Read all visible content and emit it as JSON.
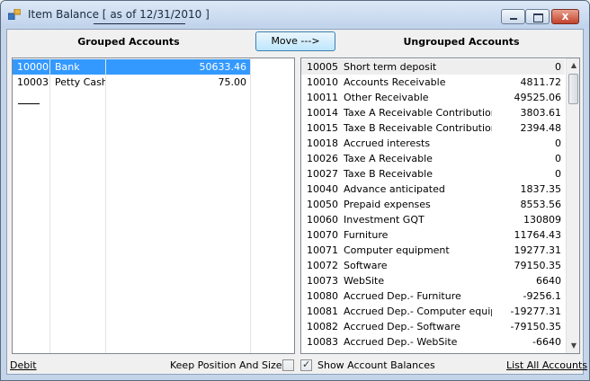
{
  "window": {
    "title_prefix": "Item Balance [",
    "title_date": "as of 12/31/2010",
    "title_suffix": "]",
    "minimize_icon": "minimize-icon",
    "maximize_icon": "maximize-icon",
    "close_glyph": "x"
  },
  "headings": {
    "grouped": "Grouped Accounts",
    "ungrouped": "Ungrouped Accounts"
  },
  "move_button": "Move --->",
  "grouped_accounts": [
    {
      "code": "10000",
      "name": "Bank",
      "value": "50633.46",
      "selected": true
    },
    {
      "code": "10003",
      "name": "Petty Cash",
      "value": "75.00",
      "selected": false
    }
  ],
  "ungrouped_accounts": [
    {
      "code": "10005",
      "name": "Short term deposit",
      "value": "0"
    },
    {
      "code": "10010",
      "name": "Accounts Receivable",
      "value": "4811.72"
    },
    {
      "code": "10011",
      "name": "Other Receivable",
      "value": "49525.06"
    },
    {
      "code": "10014",
      "name": "Taxe A Receivable Contribution",
      "value": "3803.61"
    },
    {
      "code": "10015",
      "name": "Taxe B Receivable Contribution",
      "value": "2394.48"
    },
    {
      "code": "10018",
      "name": "Accrued interests",
      "value": "0"
    },
    {
      "code": "10026",
      "name": "Taxe A Receivable",
      "value": "0"
    },
    {
      "code": "10027",
      "name": "Taxe B Receivable",
      "value": "0"
    },
    {
      "code": "10040",
      "name": "Advance anticipated",
      "value": "1837.35"
    },
    {
      "code": "10050",
      "name": "Prepaid expenses",
      "value": "8553.56"
    },
    {
      "code": "10060",
      "name": "Investment GQT",
      "value": "130809"
    },
    {
      "code": "10070",
      "name": "Furniture",
      "value": "11764.43"
    },
    {
      "code": "10071",
      "name": "Computer equipment",
      "value": "19277.31"
    },
    {
      "code": "10072",
      "name": "Software",
      "value": "79150.35"
    },
    {
      "code": "10073",
      "name": "WebSite",
      "value": "6640"
    },
    {
      "code": "10080",
      "name": "Accrued Dep.- Furniture",
      "value": "-9256.1"
    },
    {
      "code": "10081",
      "name": "Accrued Dep.- Computer equip.",
      "value": "-19277.31"
    },
    {
      "code": "10082",
      "name": "Accrued Dep.- Software",
      "value": "-79150.35"
    },
    {
      "code": "10083",
      "name": "Accrued Dep.- WebSite",
      "value": "-6640"
    }
  ],
  "footer": {
    "debit_link": "Debit",
    "keep_position_label": "Keep Position And Size",
    "keep_position_checked": false,
    "show_balances_label": "Show Account Balances",
    "show_balances_checked": true,
    "check_glyph": "✓",
    "list_all_link": "List All Accounts"
  },
  "colors": {
    "selection": "#3399ff",
    "title_bar": "#c4d5ea",
    "close_button": "#c4422b"
  }
}
